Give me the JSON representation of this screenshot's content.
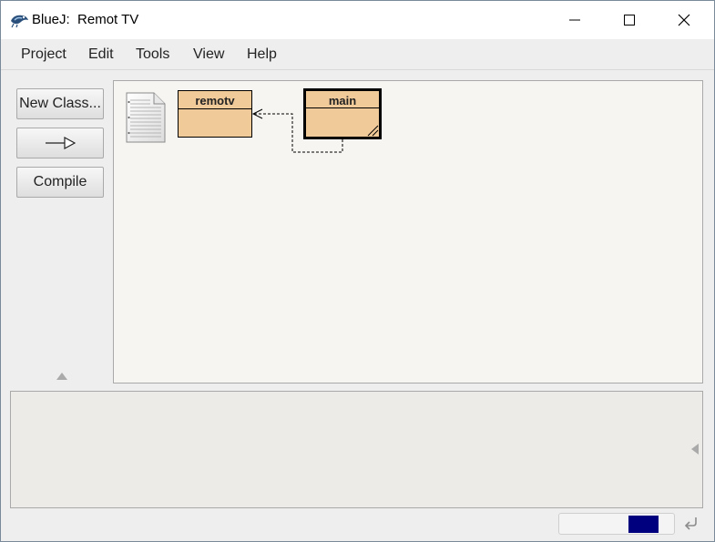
{
  "window": {
    "title": "BlueJ:  Remot TV",
    "icons": {
      "app": "bluej-bird-icon",
      "minimize": "minimize-icon",
      "maximize": "maximize-icon",
      "close": "close-icon"
    }
  },
  "menubar": {
    "items": [
      "Project",
      "Edit",
      "Tools",
      "View",
      "Help"
    ]
  },
  "toolbar": {
    "new_class_label": "New Class...",
    "new_arrow_icon": "uses-arrow-icon",
    "compile_label": "Compile",
    "toggle_icon": "triangle-up-icon"
  },
  "diagram": {
    "readme_icon": "readme-document-icon",
    "classes": [
      {
        "name": "remotv",
        "selected": false
      },
      {
        "name": "main",
        "selected": true
      }
    ],
    "class_color": "#f1ca99",
    "relations": [
      {
        "from": "main",
        "to": "remotv",
        "type": "uses",
        "style": "dashed"
      }
    ]
  },
  "terminal": {
    "collapse_icon": "triangle-left-icon"
  },
  "status": {
    "indicator_color": "#00007f",
    "return_icon": "return-arrow-icon"
  }
}
